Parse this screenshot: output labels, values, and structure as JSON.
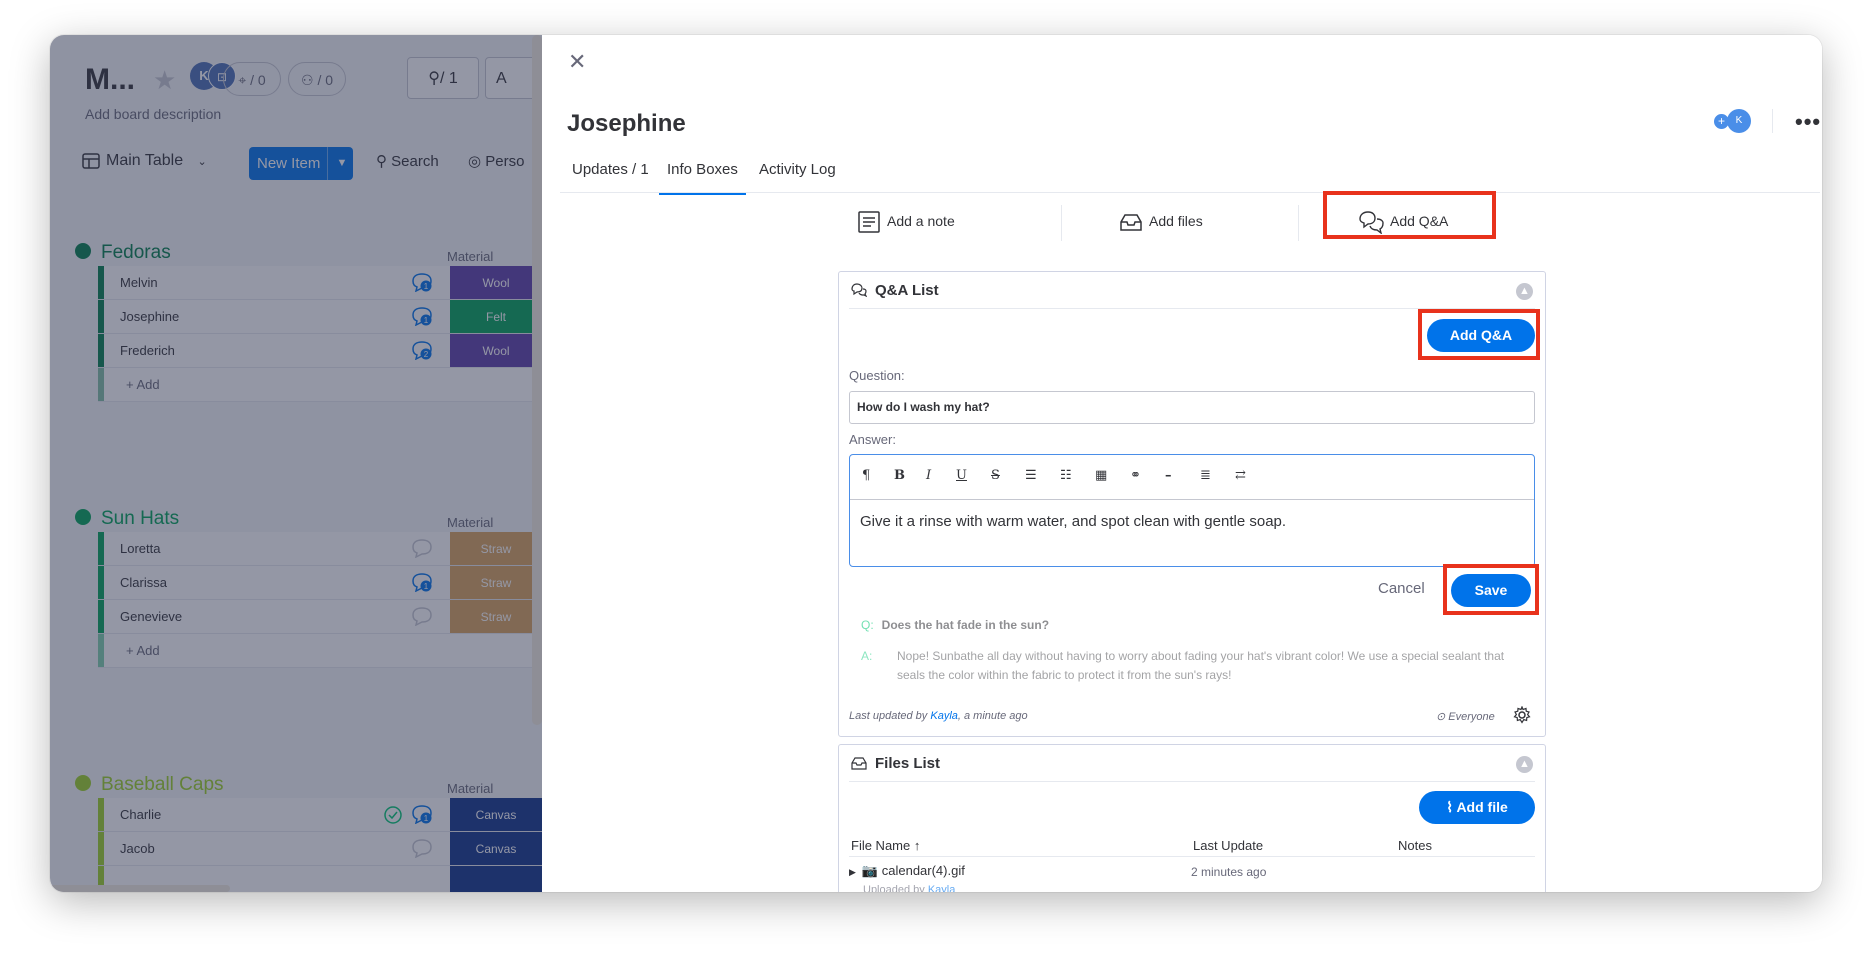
{
  "board": {
    "title": "M...",
    "description": "Add board description",
    "avatar_k": "K",
    "activity_count": "/ 0",
    "automation_count": "/ 0",
    "person_count": "/ 1",
    "button_partial": "A",
    "view_label": "Main Table",
    "new_item_label": "New Item",
    "search_label": "Search",
    "person_label": "Perso",
    "groups": [
      {
        "title": "Fedoras",
        "color": "#037f4c",
        "column_header": "Material",
        "rows": [
          {
            "name": "Melvin",
            "material": "Wool",
            "material_color": "#5d3ea8",
            "updates": "1"
          },
          {
            "name": "Josephine",
            "material": "Felt",
            "material_color": "#00a359",
            "updates": "1"
          },
          {
            "name": "Frederich",
            "material": "Wool",
            "material_color": "#5d3ea8",
            "updates": "2"
          }
        ],
        "add_label": "+ Add"
      },
      {
        "title": "Sun Hats",
        "color": "#00a359",
        "column_header": "Material",
        "rows": [
          {
            "name": "Loretta",
            "material": "Straw",
            "material_color": "#d9a35c",
            "updates": ""
          },
          {
            "name": "Clarissa",
            "material": "Straw",
            "material_color": "#d9a35c",
            "updates": "1"
          },
          {
            "name": "Genevieve",
            "material": "Straw",
            "material_color": "#d9a35c",
            "updates": ""
          }
        ],
        "add_label": "+ Add"
      },
      {
        "title": "Baseball Caps",
        "color": "#9cd326",
        "column_header": "Material",
        "rows": [
          {
            "name": "Charlie",
            "material": "Canvas",
            "material_color": "#10348b",
            "updates": "1"
          },
          {
            "name": "Jacob",
            "material": "Canvas",
            "material_color": "#10348b",
            "updates": ""
          }
        ]
      }
    ]
  },
  "item": {
    "title": "Josephine",
    "avatar": "K",
    "tabs": [
      "Updates / 1",
      "Info Boxes",
      "Activity Log"
    ],
    "active_tab": "Info Boxes"
  },
  "info_actions": {
    "add_note": "Add a note",
    "add_files": "Add files",
    "add_qa": "Add Q&A"
  },
  "qa_list": {
    "title": "Q&A List",
    "add_button": "Add Q&A",
    "question_label": "Question:",
    "question_value": "How do I wash my hat?",
    "answer_label": "Answer:",
    "answer_value": "Give it a rinse with warm water, and spot clean with gentle soap.",
    "toolbar": [
      "¶",
      "B",
      "I",
      "U",
      "S",
      "ol",
      "ul",
      "table",
      "link",
      "hr",
      "align",
      "dir"
    ],
    "cancel_label": "Cancel",
    "save_label": "Save",
    "existing_q_prefix": "Q:",
    "existing_question": "Does the hat fade in the sun?",
    "existing_a_prefix": "A:",
    "existing_answer": "Nope! Sunbathe all day without having to worry about fading your hat's vibrant color! We use a special sealant that seals the color within the fabric to protect it from the sun's rays!",
    "last_updated_prefix": "Last updated by",
    "last_updated_user": "Kayla",
    "last_updated_suffix": ", a minute ago",
    "visibility": "Everyone"
  },
  "files_list": {
    "title": "Files List",
    "add_button": "Add file",
    "columns": [
      "File Name ↑",
      "Last Update",
      "Notes"
    ],
    "files": [
      {
        "name": "calendar(4).gif",
        "updated": "2 minutes ago",
        "uploaded_prefix": "Uploaded by",
        "uploaded_by": "Kayla"
      }
    ]
  },
  "colors": {
    "accent": "#0073ea",
    "highlight": "#e8321c"
  }
}
